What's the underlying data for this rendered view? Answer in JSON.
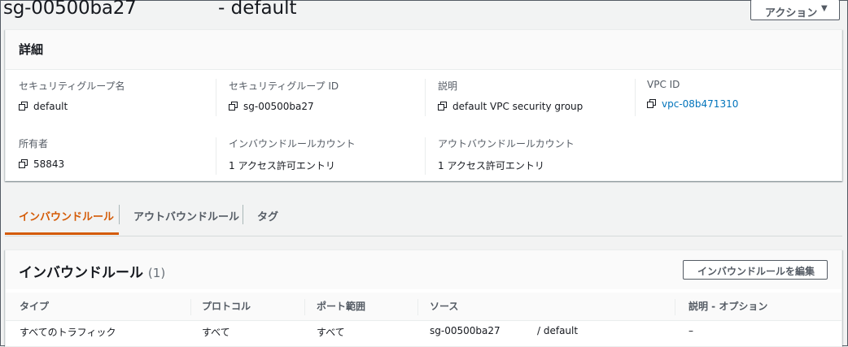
{
  "header": {
    "sg_name": "sg-00500ba27",
    "sg_suffix": "- default",
    "actions_label": "アクション",
    "actions_caret": "▼"
  },
  "details": {
    "title": "詳細",
    "fields": [
      {
        "key": "セキュリティグループ名",
        "value": "default"
      },
      {
        "key": "セキュリティグループ ID",
        "value": "sg-00500ba27"
      },
      {
        "key": "説明",
        "value": "default VPC security group"
      },
      {
        "key": "VPC ID",
        "value": "vpc-08b471310"
      },
      {
        "key": "所有者",
        "value": "58843"
      },
      {
        "key": "インバウンドルールカウント",
        "value": "1 アクセス許可エントリ"
      },
      {
        "key": "アウトバウンドルールカウント",
        "value": "1 アクセス許可エントリ"
      }
    ]
  },
  "tabs": [
    {
      "label": "インバウンドルール",
      "active": true
    },
    {
      "label": "アウトバウンドルール",
      "active": false
    },
    {
      "label": "タグ",
      "active": false
    }
  ],
  "rules": {
    "title": "インバウンドルール",
    "count": "(1)",
    "edit_label": "インバウンドルールを編集",
    "columns": [
      "タイプ",
      "プロトコル",
      "ポート範囲",
      "ソース",
      "説明 - オプション"
    ],
    "rows": [
      {
        "type": "すべてのトラフィック",
        "protocol": "すべて",
        "port": "すべて",
        "source": "sg-00500ba27",
        "source_suffix": "/ default",
        "description": "–"
      }
    ]
  },
  "colors": {
    "accent": "#d45b07",
    "link": "#0073bb",
    "text": "#16191f",
    "muted": "#545b64"
  }
}
